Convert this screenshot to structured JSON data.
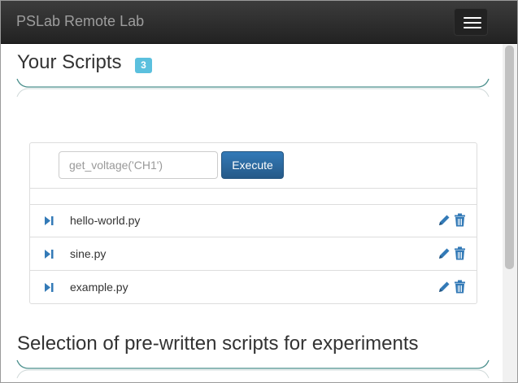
{
  "navbar": {
    "brand": "PSLab Remote Lab",
    "menu_icon": "hamburger-menu-icon"
  },
  "scripts_section": {
    "title": "Your Scripts",
    "count": "3"
  },
  "console": {
    "placeholder": "get_voltage('CH1')",
    "execute_label": "Execute"
  },
  "scripts": [
    {
      "name": "hello-world.py",
      "run_icon": "play-step-icon",
      "edit_icon": "pencil-icon",
      "delete_icon": "trash-icon"
    },
    {
      "name": "sine.py",
      "run_icon": "play-step-icon",
      "edit_icon": "pencil-icon",
      "delete_icon": "trash-icon"
    },
    {
      "name": "example.py",
      "run_icon": "play-step-icon",
      "edit_icon": "pencil-icon",
      "delete_icon": "trash-icon"
    }
  ],
  "prewritten_section": {
    "title": "Selection of pre-written scripts for experiments"
  },
  "colors": {
    "navbar": "#222222",
    "brand_text": "#9d9d9d",
    "badge": "#5bc0de",
    "primary_button": "#337ab7",
    "icon_blue": "#337ab7",
    "divider_teal": "#4a8f8c"
  }
}
